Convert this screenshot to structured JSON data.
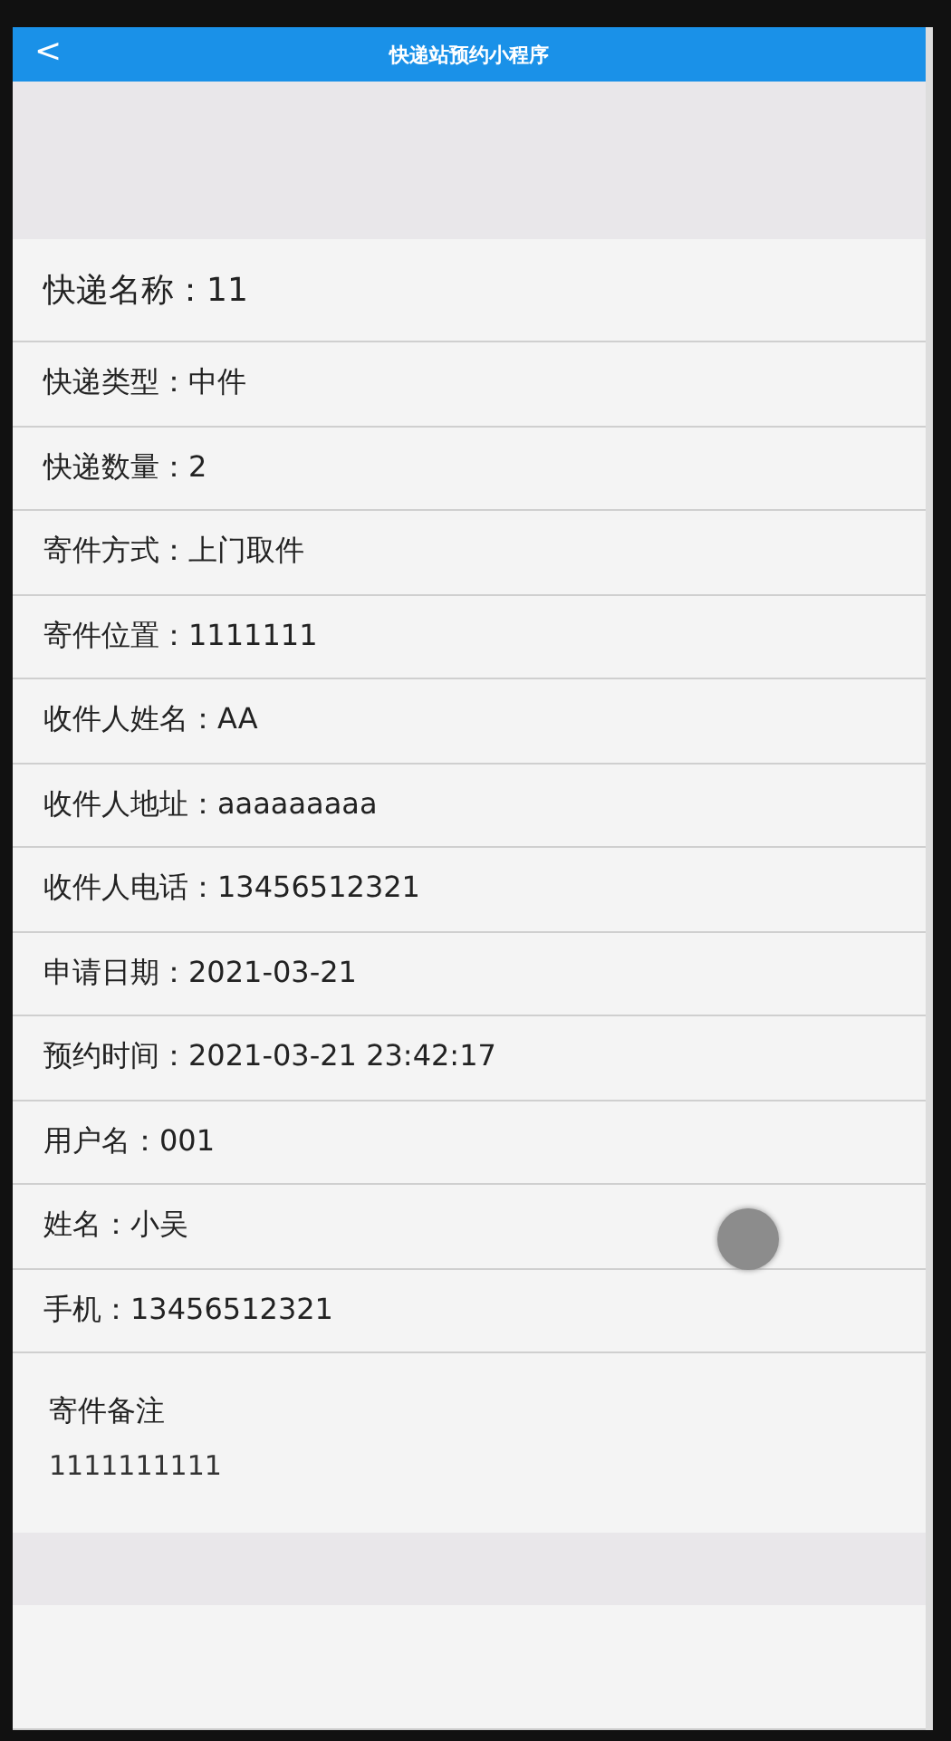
{
  "header": {
    "back_icon": "<",
    "title": "快递站预约小程序"
  },
  "fields": [
    {
      "kind": "title",
      "text": "快递名称：11"
    },
    {
      "kind": "field",
      "text": "快递类型：中件"
    },
    {
      "kind": "field",
      "text": "快递数量：2"
    },
    {
      "kind": "field",
      "text": "寄件方式：上门取件"
    },
    {
      "kind": "field",
      "text": "寄件位置：1111111"
    },
    {
      "kind": "field",
      "text": "收件人姓名：AA"
    },
    {
      "kind": "field",
      "text": "收件人地址：aaaaaaaaa"
    },
    {
      "kind": "field",
      "text": "收件人电话：13456512321"
    },
    {
      "kind": "field",
      "text": "申请日期：2021-03-21"
    },
    {
      "kind": "field",
      "text": "预约时间：2021-03-21 23:42:17"
    },
    {
      "kind": "field",
      "text": "用户名：001"
    },
    {
      "kind": "field",
      "text": "姓名：小吴"
    },
    {
      "kind": "field",
      "text": "手机：13456512321"
    }
  ],
  "remark": {
    "label": "寄件备注",
    "value": "1111111111"
  }
}
